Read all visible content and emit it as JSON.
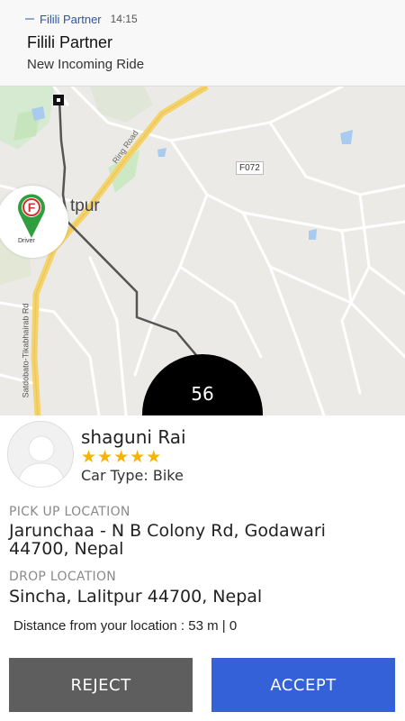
{
  "notification": {
    "app_name": "Filili Partner",
    "time": "14:15",
    "title": "Filili Partner",
    "text": "New Incoming Ride"
  },
  "map": {
    "route_badge": "F072",
    "city_label": "tpur",
    "road_label": "Ring Road",
    "side_road_label": "Satdobato-Tikabhairab Rd",
    "driver_label": "Driver",
    "driver_logo_letter": "F",
    "counter": "56",
    "colors": {
      "route_line": "#555555",
      "major_road": "#f5d36b",
      "park": "#cde8c4",
      "water": "#a9cbf0"
    }
  },
  "rider": {
    "name": "shaguni Rai",
    "rating_stars": 5,
    "car_type": "Car Type: Bike"
  },
  "pickup": {
    "label": "PICK UP LOCATION",
    "value": "Jarunchaa - N B Colony Rd, Godawari 44700, Nepal"
  },
  "drop": {
    "label": "DROP LOCATION",
    "value": "Sincha, Lalitpur 44700, Nepal"
  },
  "distance_text": "Distance from your location : 53 m | 0",
  "actions": {
    "reject": "REJECT",
    "accept": "ACCEPT",
    "reject_color": "#5e5e5e",
    "accept_color": "#3561d8"
  }
}
